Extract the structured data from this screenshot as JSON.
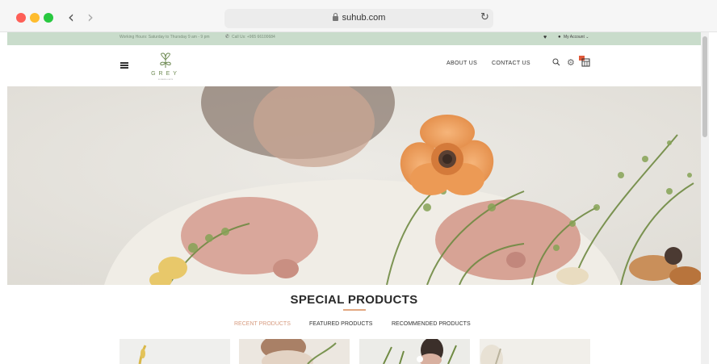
{
  "browser": {
    "url": "suhub.com"
  },
  "infobar": {
    "hours": "Working Hours: Saturday to Thursday 9 am - 9 pm",
    "phone": "Call Us: +965 66100684",
    "account": "My Account"
  },
  "header": {
    "logo_text": "GREY",
    "logo_sub": "FLOWERS & GIFTS",
    "nav": {
      "about": "ABOUT US",
      "contact": "CONTACT US"
    }
  },
  "products": {
    "title": "SPECIAL PRODUCTS",
    "tabs": {
      "recent": "RECENT PRODUCTS",
      "featured": "FEATURED PRODUCTS",
      "recommended": "RECOMMENDED PRODUCTS"
    }
  },
  "colors": {
    "infobar": "#c9dccb",
    "accent": "#d79b7f",
    "logo": "#6e8a53"
  },
  "icons": [
    "chevron-left-icon",
    "chevron-right-icon",
    "lock-icon",
    "reload-icon",
    "phone-icon",
    "heart-icon",
    "user-icon",
    "menu-icon",
    "search-icon",
    "settings-icon",
    "cart-icon"
  ]
}
